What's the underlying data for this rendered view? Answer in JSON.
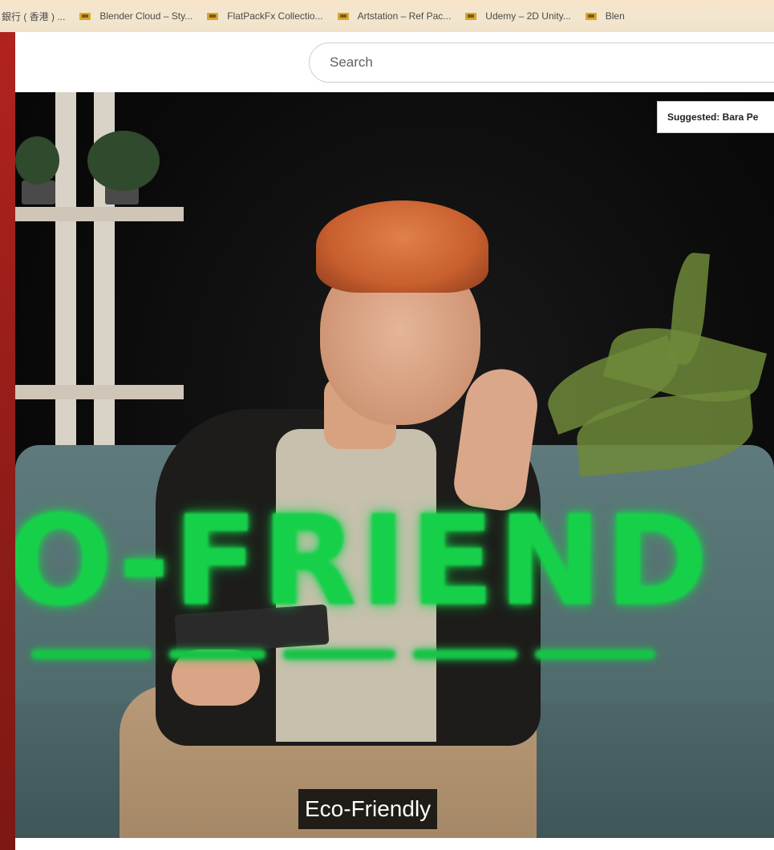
{
  "bookmarks_bar": {
    "items": [
      {
        "label": "銀行 ( 香港 ) ...",
        "icon": "folder-icon"
      },
      {
        "label": "Blender Cloud – Sty...",
        "icon": "folder-icon"
      },
      {
        "label": "FlatPackFx Collectio...",
        "icon": "folder-icon"
      },
      {
        "label": "Artstation – Ref Pac...",
        "icon": "folder-icon"
      },
      {
        "label": "Udemy – 2D Unity...",
        "icon": "folder-icon"
      },
      {
        "label": "Blen",
        "icon": "folder-icon"
      }
    ]
  },
  "header": {
    "search_placeholder": "Search"
  },
  "video": {
    "suggested_label": "Suggested: Bara Pe",
    "overlay_text": "O-FRIEND",
    "caption": "Eco-Friendly"
  },
  "colors": {
    "overlay_green": "#17d04a",
    "frame_red": "#9a1f1c"
  }
}
